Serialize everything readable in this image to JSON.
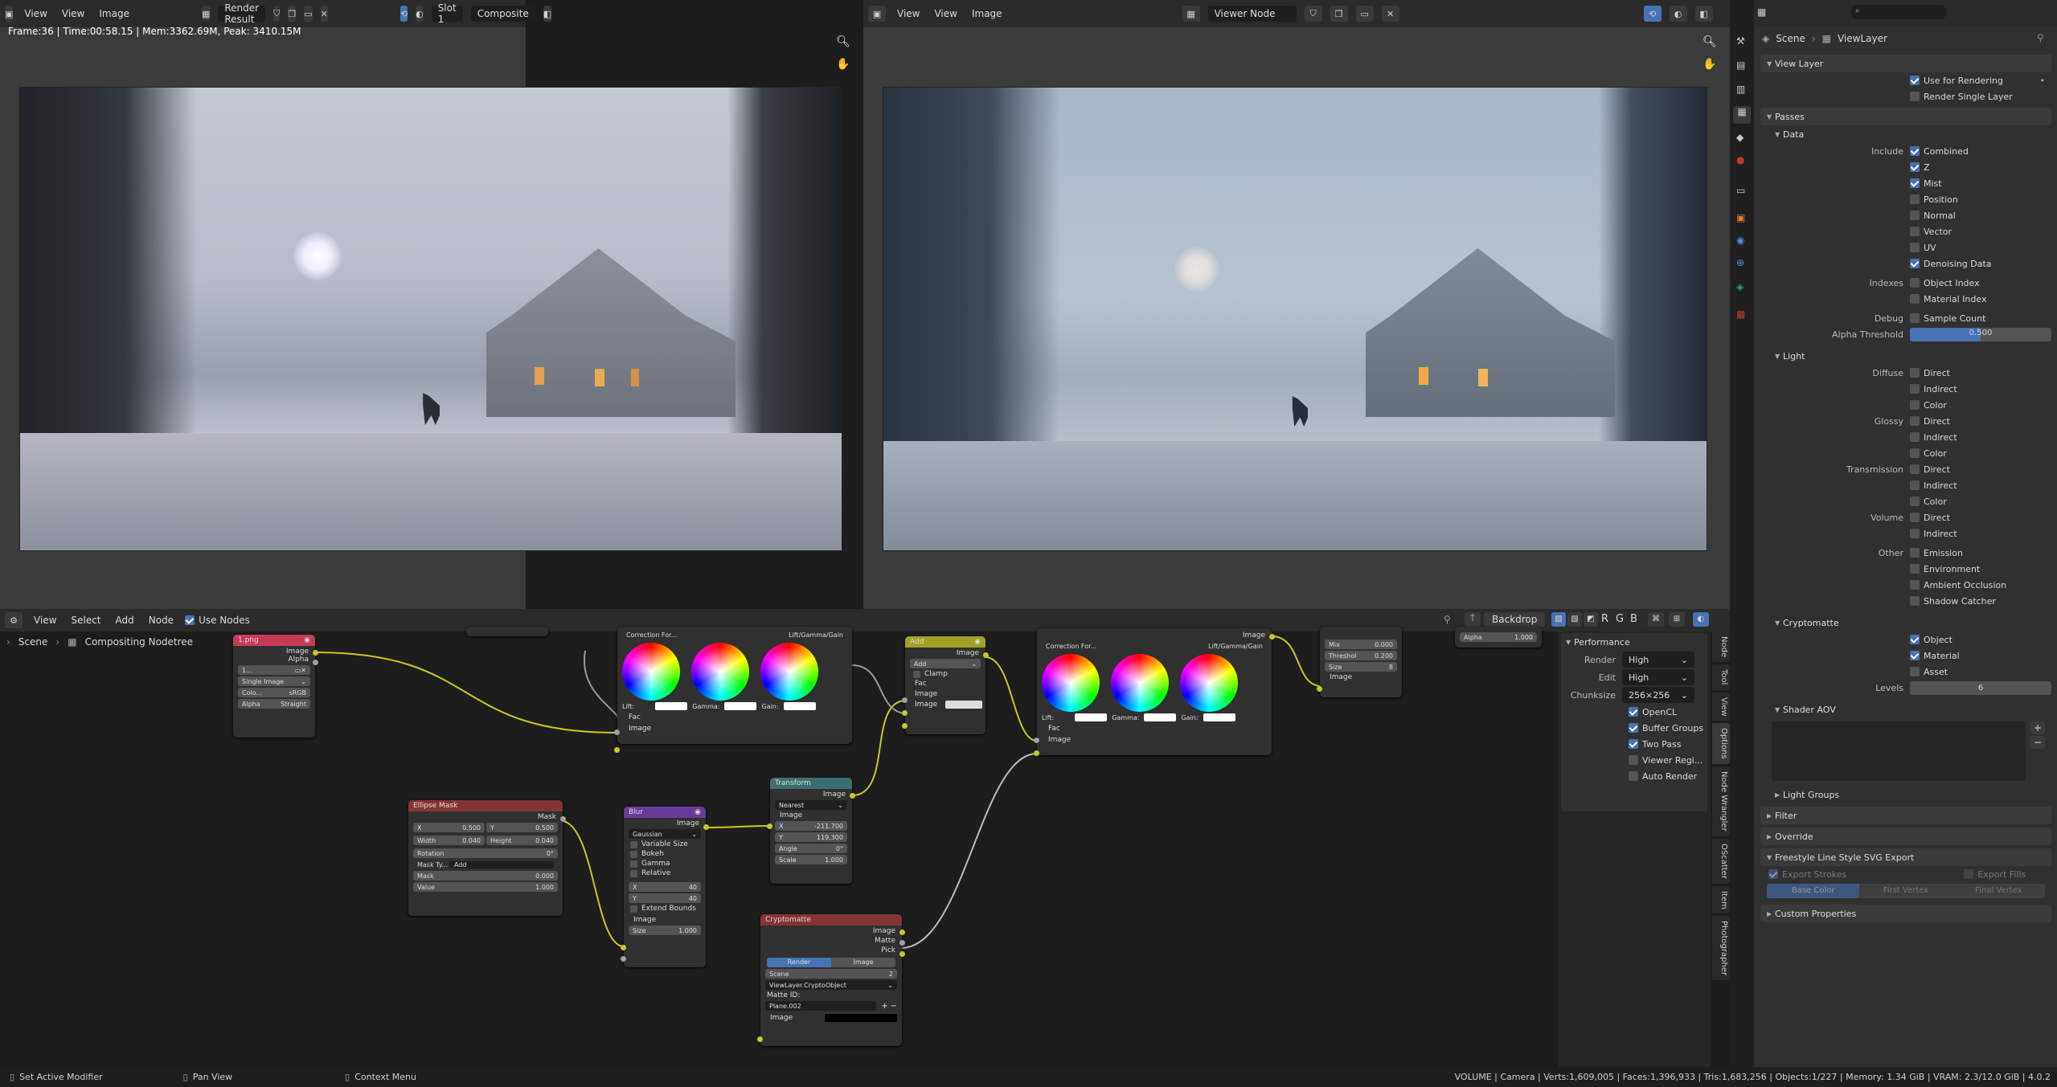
{
  "left_editor": {
    "menus": [
      "View",
      "View",
      "Image"
    ],
    "image_name": "Render Result",
    "slot": "Slot 1",
    "layer": "Composite",
    "stats": "Frame:36 | Time:00:58.15 | Mem:3362.69M, Peak: 3410.15M"
  },
  "right_editor": {
    "menus": [
      "View",
      "View",
      "Image"
    ],
    "image_name": "Viewer Node"
  },
  "properties": {
    "search_placeholder": "",
    "breadcrumb_scene": "Scene",
    "breadcrumb_layer": "ViewLayer",
    "view_layer_title": "View Layer",
    "use_for_rendering": "Use for Rendering",
    "render_single_layer": "Render Single Layer",
    "passes_title": "Passes",
    "data_title": "Data",
    "include_label": "Include",
    "combined": "Combined",
    "z": "Z",
    "mist": "Mist",
    "position": "Position",
    "normal": "Normal",
    "vector": "Vector",
    "uv": "UV",
    "denoising": "Denoising Data",
    "indexes_label": "Indexes",
    "object_index": "Object Index",
    "material_index": "Material Index",
    "debug_label": "Debug",
    "sample_count": "Sample Count",
    "alpha_threshold_label": "Alpha Threshold",
    "alpha_threshold_value": "0.500",
    "light_title": "Light",
    "diffuse": "Diffuse",
    "glossy": "Glossy",
    "transmission": "Transmission",
    "volume": "Volume",
    "other": "Other",
    "direct": "Direct",
    "indirect": "Indirect",
    "color": "Color",
    "emission": "Emission",
    "environment": "Environment",
    "ambient_occlusion": "Ambient Occlusion",
    "shadow_catcher": "Shadow Catcher",
    "cryptomatte_title": "Cryptomatte",
    "object": "Object",
    "material": "Material",
    "asset": "Asset",
    "levels_label": "Levels",
    "levels_value": "6",
    "shader_aov_title": "Shader AOV",
    "light_groups": "Light Groups",
    "filter": "Filter",
    "override": "Override",
    "freestyle": "Freestyle Line Style SVG Export",
    "export_strokes": "Export Strokes",
    "export_fills": "Export Fills",
    "base_color": "Base Color",
    "first_vertex": "First Vertex",
    "final_vertex": "Final Vertex",
    "custom_properties": "Custom Properties"
  },
  "node_editor": {
    "menus": [
      "View",
      "Select",
      "Add",
      "Node"
    ],
    "use_nodes": "Use Nodes",
    "breadcrumb_scene": "Scene",
    "breadcrumb_tree": "Compositing Nodetree",
    "backdrop": "Backdrop",
    "channels": [
      "R",
      "G",
      "B"
    ],
    "side_tabs": [
      "Node",
      "Tool",
      "View",
      "Options",
      "Node Wrangler",
      "OScatter",
      "Item",
      "Photographer"
    ],
    "performance": {
      "title": "Performance",
      "render_label": "Render",
      "render_value": "High",
      "edit_label": "Edit",
      "edit_value": "High",
      "chunksize_label": "Chunksize",
      "chunksize_value": "256×256",
      "opencl": "OpenCL",
      "buffer_groups": "Buffer Groups",
      "two_pass": "Two Pass",
      "viewer_region": "Viewer Regi...",
      "auto_render": "Auto Render"
    }
  },
  "nodes": {
    "image": {
      "title": "1.png",
      "out_image": "Image",
      "out_alpha": "Alpha",
      "field": "1...",
      "source": "Single Image",
      "color_label": "Colo...",
      "color_value": "sRGB",
      "alpha_label": "Alpha",
      "alpha_value": "Straight"
    },
    "cb1": {
      "title": "Correction For...",
      "mode": "Lift/Gamma/Gain",
      "lift": "Lift:",
      "gamma": "Gamma:",
      "gain": "Gain:",
      "fac": "Fac",
      "image": "Image"
    },
    "add": {
      "title": "Add",
      "out": "Image",
      "mode": "Add",
      "clamp": "Clamp",
      "fac": "Fac",
      "image1": "Image",
      "image2": "Image"
    },
    "cb2": {
      "title": "Correction For...",
      "mode": "Lift/Gamma/Gain",
      "out": "Image",
      "lift": "Lift:",
      "gamma": "Gamma:",
      "gain": "Gain:",
      "fac": "Fac",
      "image": "Image"
    },
    "glare": {
      "mix_label": "Mix",
      "mix_value": "0.000",
      "thr_label": "Threshol",
      "thr_value": "0.200",
      "size_label": "Size",
      "size_value": "8",
      "image": "Image"
    },
    "alpha": {
      "label": "Alpha",
      "value": "1.000"
    },
    "ellipse": {
      "title": "Ellipse Mask",
      "out": "Mask",
      "x_label": "X",
      "x_value": "0.500",
      "y_label": "Y",
      "y_value": "0.500",
      "w_label": "Width",
      "w_value": "0.040",
      "h_label": "Height",
      "h_value": "0.040",
      "rot_label": "Rotation",
      "rot_value": "0°",
      "masktype_label": "Mask Ty...",
      "masktype_value": "Add",
      "mask_label": "Mask",
      "mask_value": "0.000",
      "value_label": "Value",
      "value_value": "1.000"
    },
    "blur": {
      "title": "Blur",
      "out": "Image",
      "filter": "Gaussian",
      "variable": "Variable Size",
      "bokeh": "Bokeh",
      "gamma": "Gamma",
      "relative": "Relative",
      "x_label": "X",
      "x_value": "40",
      "y_label": "Y",
      "y_value": "40",
      "extend": "Extend Bounds",
      "image": "Image",
      "size_label": "Size",
      "size_value": "1.000"
    },
    "transform": {
      "title": "Transform",
      "out": "Image",
      "filter": "Nearest",
      "image": "Image",
      "x_label": "X",
      "x_value": "-211.700",
      "y_label": "Y",
      "y_value": "119.300",
      "angle_label": "Angle",
      "angle_value": "0°",
      "scale_label": "Scale",
      "scale_value": "1.000"
    },
    "crypto": {
      "title": "Cryptomatte",
      "out_image": "Image",
      "out_matte": "Matte",
      "out_pick": "Pick",
      "tab_render": "Render",
      "tab_image": "Image",
      "scene": "Scene",
      "scene_users": "2",
      "layer": "ViewLayer.CryptoObject",
      "matte_id_label": "Matte ID:",
      "matte_id": "Plane.002",
      "image": "Image"
    }
  },
  "status_bar": {
    "left1": "Set Active Modifier",
    "left2": "Pan View",
    "left3": "Context Menu",
    "right": "VOLUME | Camera | Verts:1,609,005 | Faces:1,396,933 | Tris:1,683,256 | Objects:1/227 | Memory: 1.34 GiB | VRAM: 2.3/12.0 GiB | 4.0.2"
  },
  "colors": {
    "accent": "#4772b3",
    "header": "#2b2b2b",
    "panel": "#303030",
    "node_input": "#c53b58",
    "node_color": "#a0a026",
    "node_filter": "#6a3a9a",
    "node_distort": "#3b6f6f",
    "node_matte": "#843434"
  }
}
